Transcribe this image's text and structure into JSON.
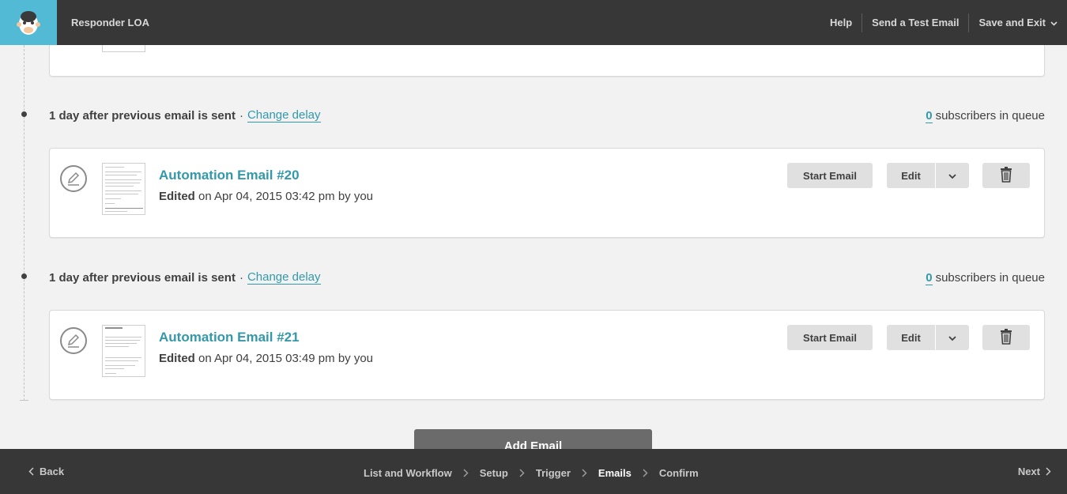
{
  "header": {
    "app_title": "Responder LOA",
    "links": {
      "help": "Help",
      "send_test": "Send a Test Email",
      "save_exit": "Save and Exit"
    }
  },
  "colors": {
    "brand": "#52bad5",
    "dark_bar": "#373737",
    "link": "#3399aa",
    "button": "#e0e0e0"
  },
  "icons": [
    "mailchimp-logo-icon",
    "pencil-icon",
    "chevron-down-icon",
    "trash-icon",
    "chevron-left-icon",
    "chevron-right-icon"
  ],
  "delays": [
    {
      "text": "1 day after previous email is sent",
      "change_label": "Change delay",
      "queue_count": "0",
      "queue_label": "subscribers in queue"
    },
    {
      "text": "1 day after previous email is sent",
      "change_label": "Change delay",
      "queue_count": "0",
      "queue_label": "subscribers in queue"
    }
  ],
  "emails": [
    {
      "title": "Automation Email #20",
      "edited_label": "Edited",
      "edited_rest": "on Apr 04, 2015 03:42 pm by you",
      "start_label": "Start Email",
      "edit_label": "Edit"
    },
    {
      "title": "Automation Email #21",
      "edited_label": "Edited",
      "edited_rest": "on Apr 04, 2015 03:49 pm by you",
      "start_label": "Start Email",
      "edit_label": "Edit"
    }
  ],
  "add_email_label": "Add Email",
  "footer": {
    "back": "Back",
    "next": "Next",
    "steps": [
      "List and Workflow",
      "Setup",
      "Trigger",
      "Emails",
      "Confirm"
    ],
    "active_step": "Emails"
  }
}
